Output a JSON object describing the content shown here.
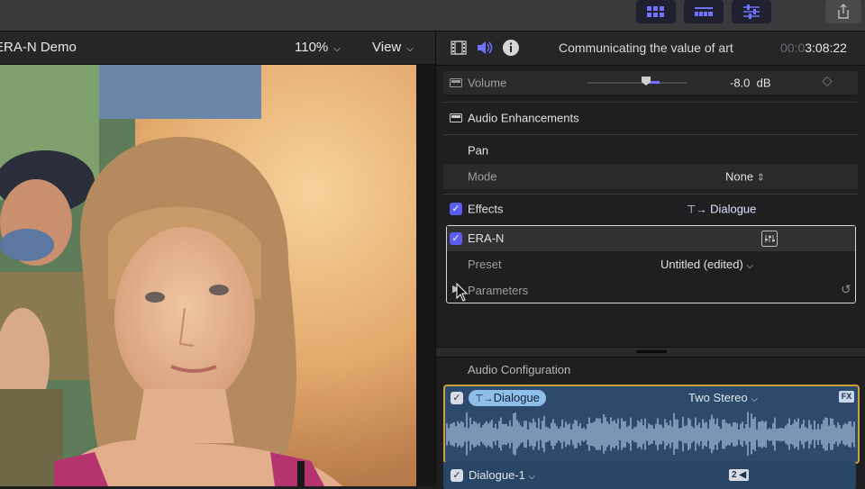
{
  "viewer": {
    "title": "ERA-N Demo",
    "zoom": "110%",
    "view_label": "View"
  },
  "inspector": {
    "clip_title": "Communicating the value of art",
    "timecode_dim": "00:0",
    "timecode": "3:08:22",
    "volume": {
      "label": "Volume",
      "value": "-8.0  dB",
      "slider_fraction": 0.6
    },
    "audio_enhancements_label": "Audio Enhancements",
    "pan_label": "Pan",
    "mode": {
      "label": "Mode",
      "value": "None"
    },
    "effects": {
      "label": "Effects",
      "role": "Dialogue"
    },
    "effect_plugin": {
      "name": "ERA-N",
      "preset_label": "Preset",
      "preset_value": "Untitled (edited)",
      "parameters_label": "Parameters"
    }
  },
  "audio_configuration": {
    "label": "Audio Configuration",
    "clip": {
      "role": "Dialogue",
      "channels": "Two Stereo",
      "fx_badge": "FX"
    },
    "subclip": {
      "role": "Dialogue-1",
      "badge": "2"
    }
  },
  "colors": {
    "accent": "#5a5ef0",
    "clip_border": "#c9a23a",
    "clip_bg": "#2d4a6c",
    "waveform": "#8fa8c6"
  }
}
